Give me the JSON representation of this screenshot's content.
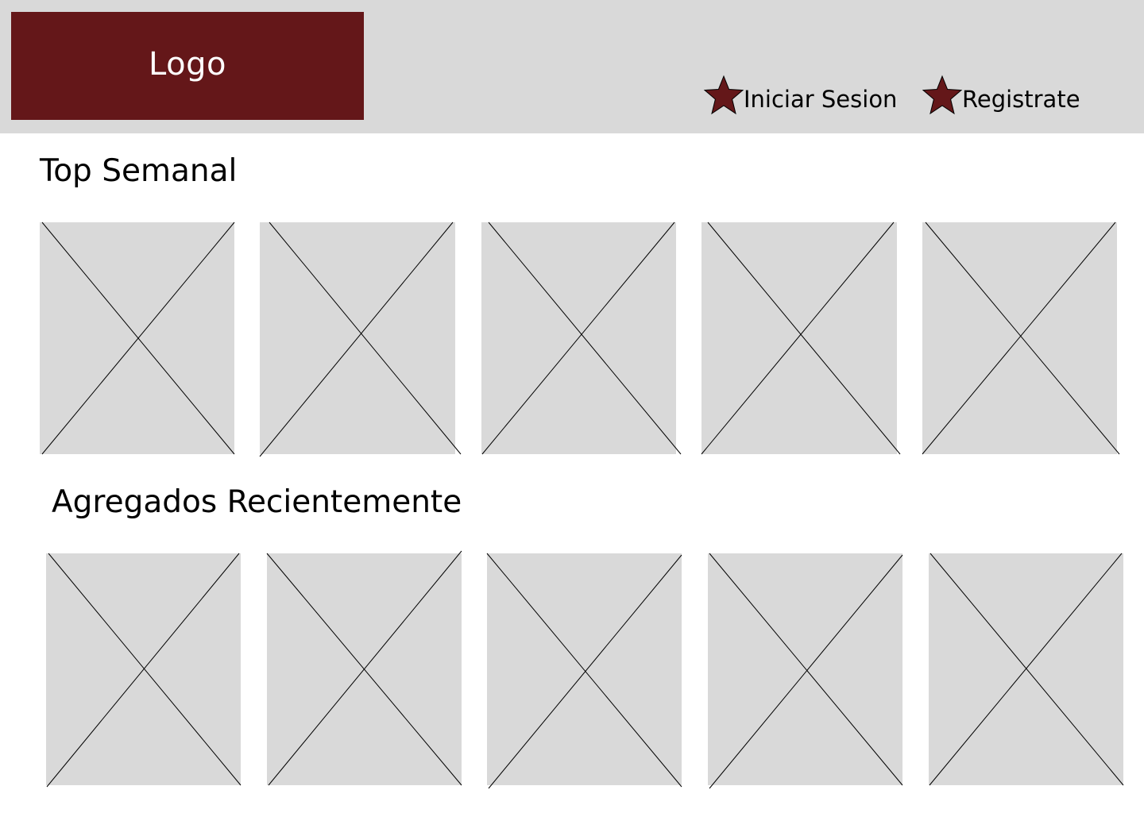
{
  "header": {
    "logo_text": "Logo",
    "links": [
      {
        "label": "Iniciar Sesion",
        "icon": "star-icon"
      },
      {
        "label": "Registrate",
        "icon": "star-icon"
      }
    ]
  },
  "sections": [
    {
      "title": "Top Semanal",
      "item_count": 5
    },
    {
      "title": "Agregados Recientemente",
      "item_count": 5
    }
  ],
  "colors": {
    "accent": "#641719",
    "header_bg": "#d9d9d9",
    "placeholder_bg": "#d9d9d9"
  }
}
